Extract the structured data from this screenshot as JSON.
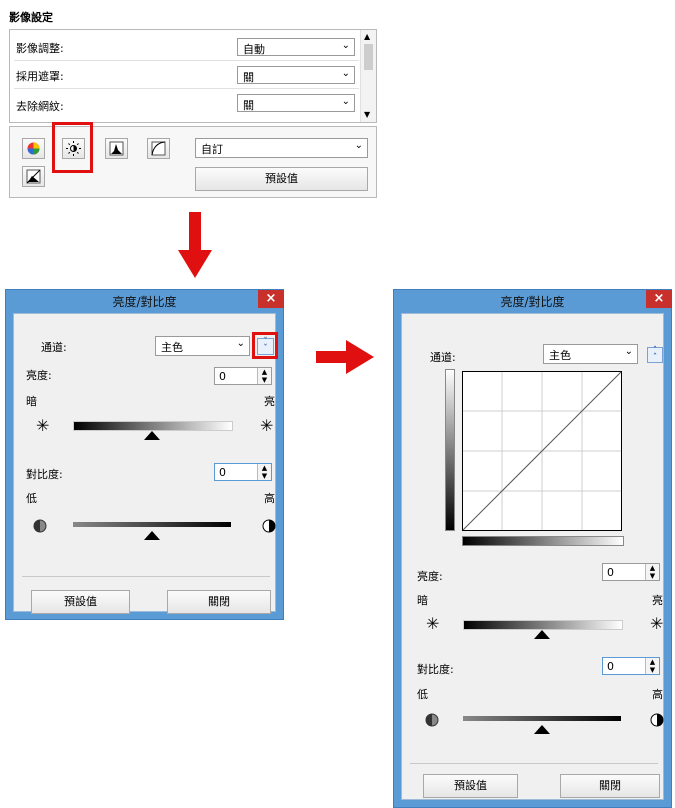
{
  "image_settings": {
    "title": "影像設定",
    "rows": [
      {
        "label": "影像調整:",
        "value": "自動"
      },
      {
        "label": "採用遮罩:",
        "value": "關"
      },
      {
        "label": "去除網紋:",
        "value": "關"
      }
    ],
    "tool_icons": [
      "color-balance-icon",
      "brightness-contrast-icon",
      "histogram-icon",
      "tone-curve-icon",
      "threshold-icon"
    ],
    "preset_value": "自訂",
    "defaults_button": "預設值"
  },
  "dialog_small": {
    "title": "亮度/對比度",
    "close": "×",
    "channel_label": "通道:",
    "channel_value": "主色",
    "expand_icon": "double-chevron-down-icon",
    "brightness_label": "亮度:",
    "brightness_value": "0",
    "dark_label": "暗",
    "bright_label": "亮",
    "brightness_level": 0.5,
    "contrast_label": "對比度:",
    "contrast_value": "0",
    "low_label": "低",
    "high_label": "高",
    "contrast_level": 0.5,
    "defaults_button": "預設值",
    "close_button": "關閉"
  },
  "dialog_large": {
    "title": "亮度/對比度",
    "close": "×",
    "channel_label": "通道:",
    "channel_value": "主色",
    "collapse_icon": "double-chevron-up-icon",
    "brightness_label": "亮度:",
    "brightness_value": "0",
    "dark_label": "暗",
    "bright_label": "亮",
    "brightness_level": 0.5,
    "contrast_label": "對比度:",
    "contrast_value": "0",
    "low_label": "低",
    "high_label": "高",
    "contrast_level": 0.5,
    "defaults_button": "預設值",
    "close_button": "關閉"
  },
  "colors": {
    "highlight": "#e01010",
    "title_bar": "#5b9bd5",
    "close_button": "#c8302c"
  }
}
